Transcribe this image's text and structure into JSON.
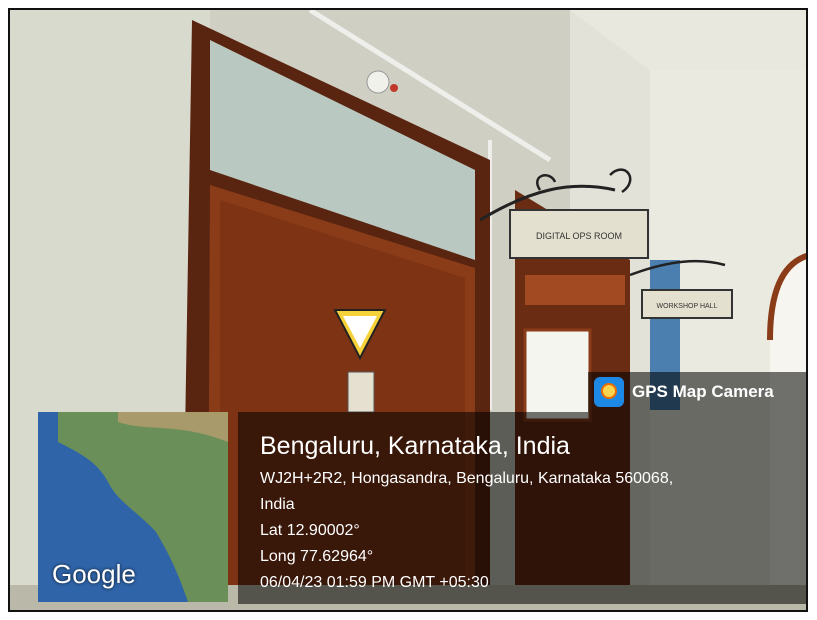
{
  "overlay": {
    "app_badge": "GPS Map Camera",
    "place_title": "Bengaluru, Karnataka, India",
    "address_line1": "WJ2H+2R2, Hongasandra, Bengaluru, Karnataka 560068,",
    "address_line2": "India",
    "latitude": "Lat 12.90002°",
    "longitude": "Long 77.62964°",
    "timestamp": "06/04/23 01:59 PM GMT +05:30",
    "map_brand": "Google"
  },
  "signage": {
    "sign_main": "DIGITAL OPS ROOM",
    "sign_secondary": "WORKSHOP HALL"
  },
  "icons": {
    "app_logo": "gps-camera-logo-icon",
    "warning_sign": "caution-triangle-icon"
  },
  "colors": {
    "door": "#7a3416",
    "wall": "#d4d4c8",
    "overlay": "rgba(0,0,0,0.55)",
    "sea": "#2f64a8",
    "land": "#6b8f58"
  }
}
